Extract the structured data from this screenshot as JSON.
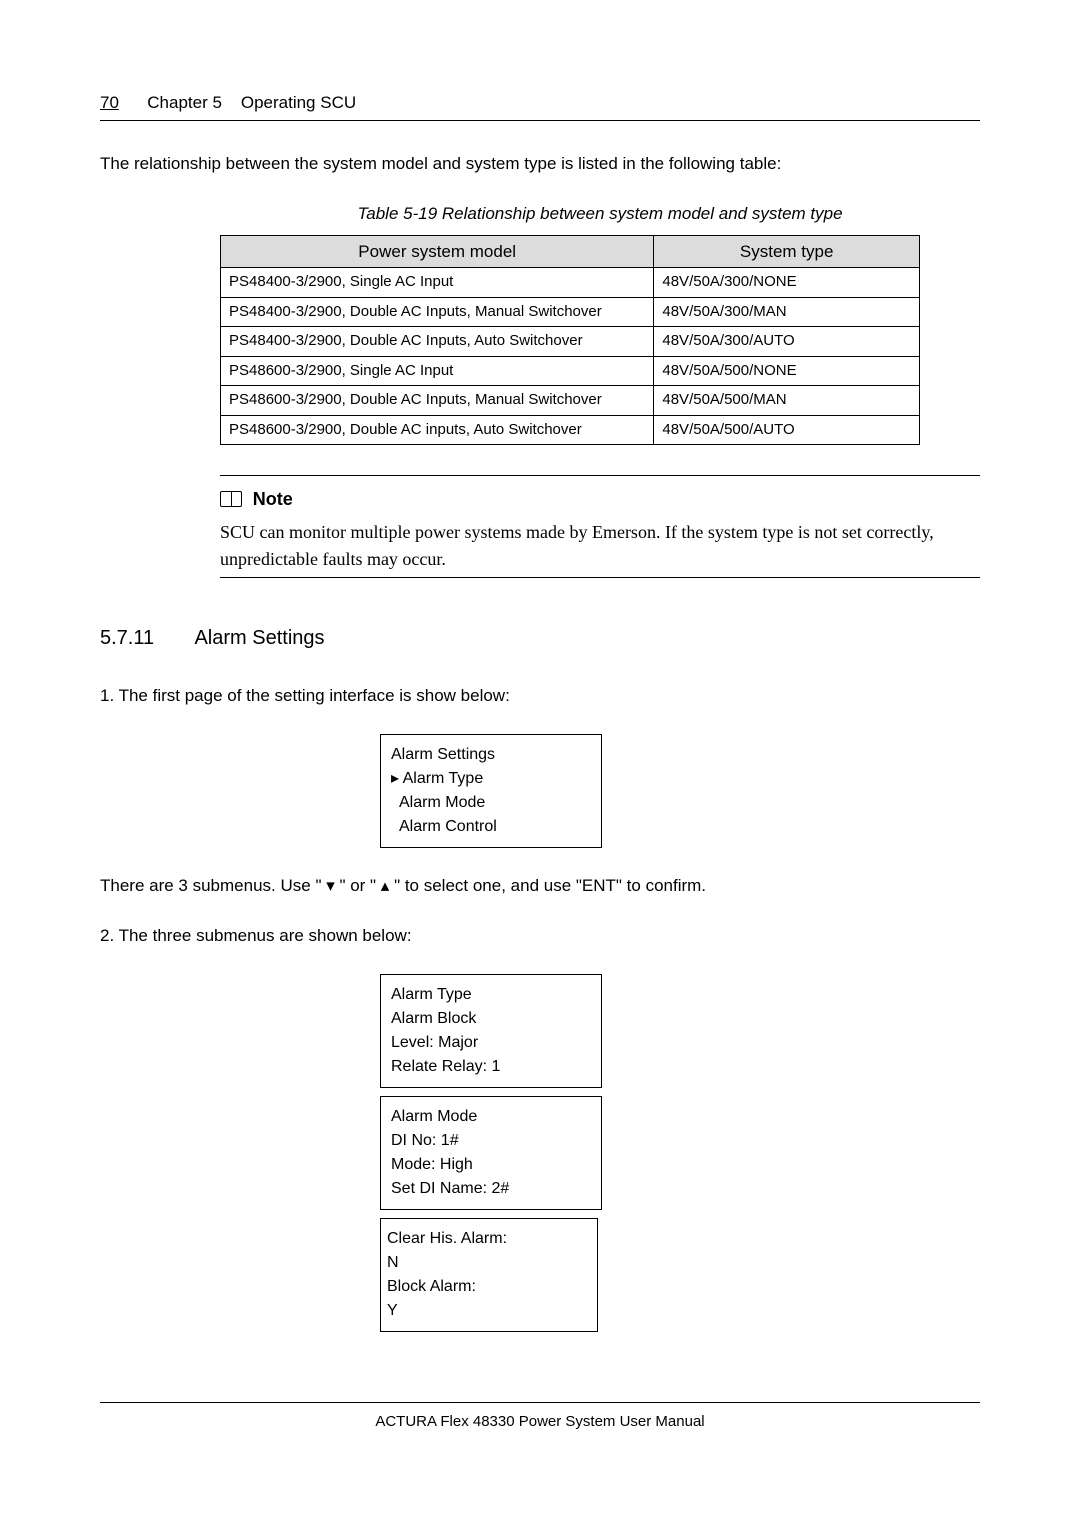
{
  "header": {
    "page_num": "70",
    "chapter": "Chapter 5",
    "title": "Operating SCU"
  },
  "intro_text": "The relationship between the system model and system type is listed in the following table:",
  "table_caption": "Table 5-19    Relationship between system model and system type",
  "table_headers": {
    "col1": "Power system model",
    "col2": "System type"
  },
  "table_rows": [
    {
      "model": "PS48400-3/2900, Single AC Input",
      "type": "48V/50A/300/NONE"
    },
    {
      "model": "PS48400-3/2900, Double AC Inputs, Manual Switchover",
      "type": "48V/50A/300/MAN"
    },
    {
      "model": "PS48400-3/2900, Double AC Inputs, Auto Switchover",
      "type": "48V/50A/300/AUTO"
    },
    {
      "model": "PS48600-3/2900, Single AC Input",
      "type": "48V/50A/500/NONE"
    },
    {
      "model": "PS48600-3/2900, Double AC Inputs, Manual Switchover",
      "type": "48V/50A/500/MAN"
    },
    {
      "model": "PS48600-3/2900, Double AC inputs, Auto Switchover",
      "type": "48V/50A/500/AUTO"
    }
  ],
  "note": {
    "label": "Note",
    "body": "SCU can monitor multiple power systems made by Emerson. If the system type is not set correctly, unpredictable faults may occur."
  },
  "section": {
    "num": "5.7.11",
    "title": "Alarm Settings"
  },
  "step1": "1. The first page of the setting interface is show below:",
  "screen1": {
    "title": "Alarm Settings",
    "items": [
      "▸ Alarm Type",
      "  Alarm Mode",
      "  Alarm Control"
    ]
  },
  "submenu_text": "There are 3 submenus. Use \" ▾ \" or \" ▴ \" to select one, and use \"ENT\" to confirm.",
  "step2": "2. The three submenus are shown below:",
  "screen2": {
    "lines": [
      "Alarm Type",
      "Alarm Block",
      "Level: Major",
      "Relate Relay: 1"
    ]
  },
  "screen3": {
    "lines": [
      "Alarm Mode",
      "DI No: 1#",
      "Mode: High",
      "Set DI Name: 2#"
    ]
  },
  "screen4": {
    "lines": [
      "Clear His. Alarm:",
      "N",
      "Block Alarm:",
      "Y"
    ]
  },
  "footer": "ACTURA Flex 48330 Power System    User Manual"
}
